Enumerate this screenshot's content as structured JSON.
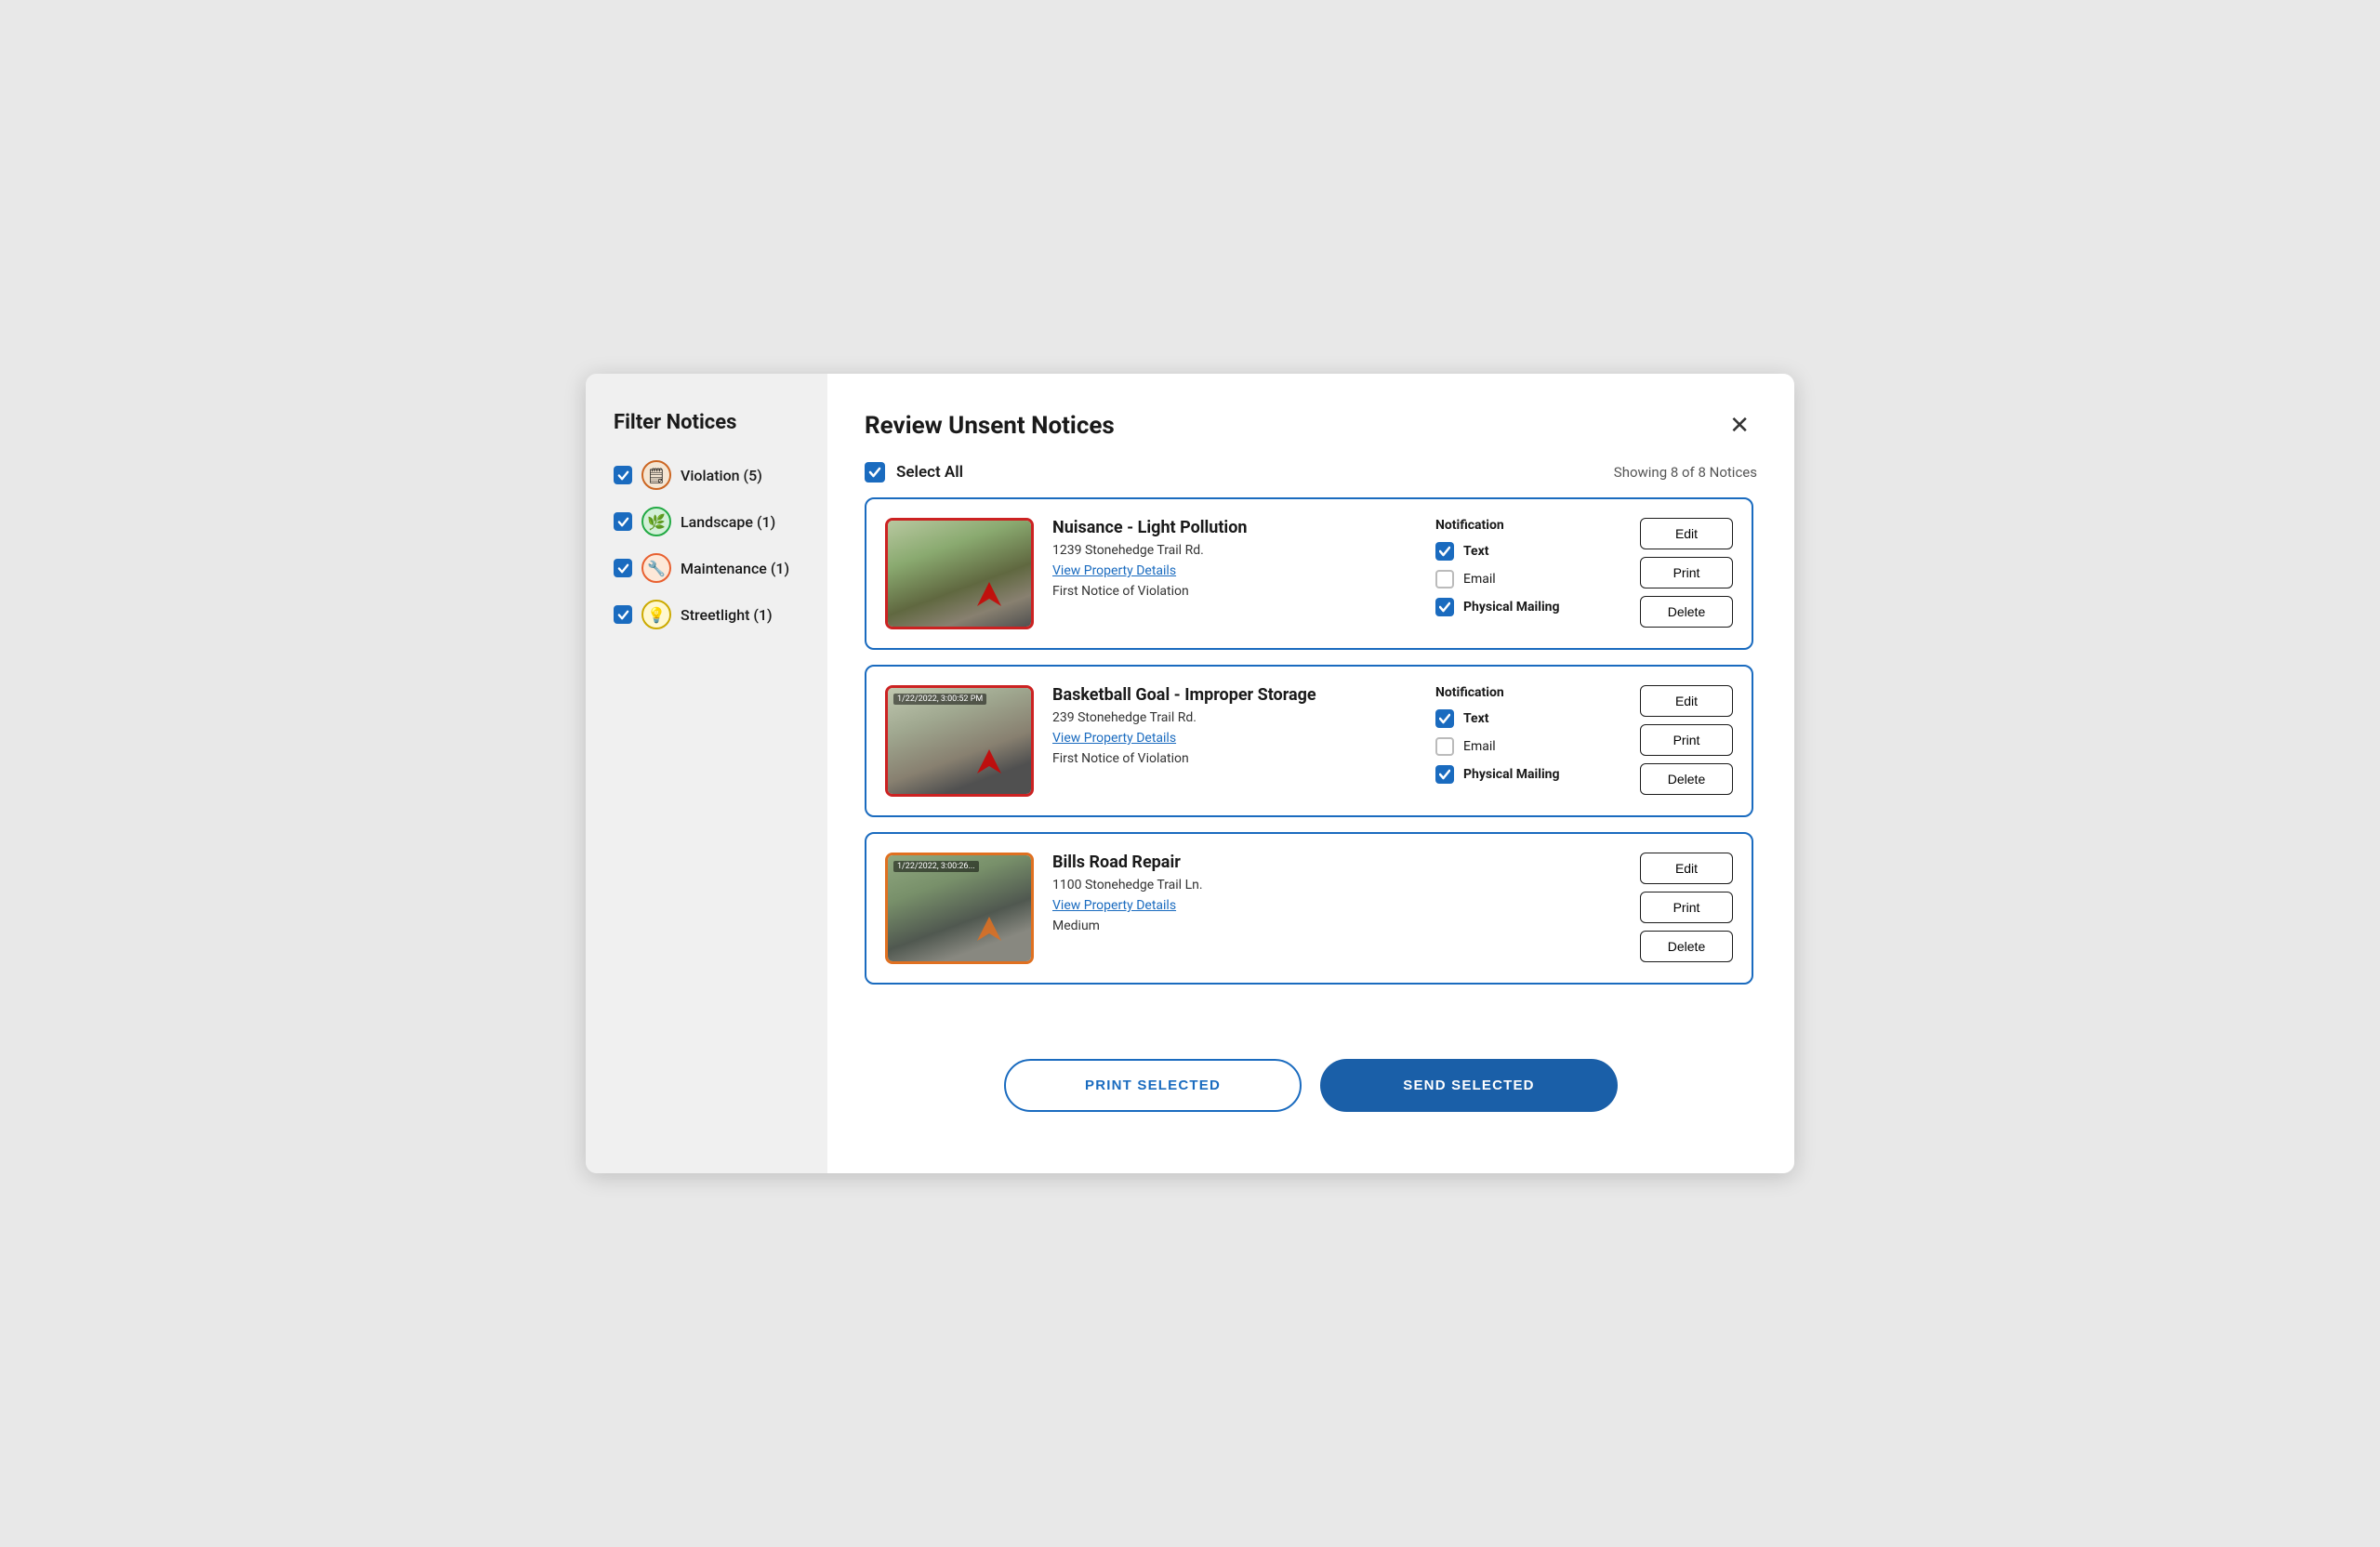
{
  "sidebar": {
    "title": "Filter Notices",
    "filters": [
      {
        "id": "violation",
        "label": "Violation (5)",
        "icon": "🗒",
        "iconClass": "icon-violation",
        "checked": true
      },
      {
        "id": "landscape",
        "label": "Landscape (1)",
        "icon": "🌿",
        "iconClass": "icon-landscape",
        "checked": true
      },
      {
        "id": "maintenance",
        "label": "Maintenance (1)",
        "icon": "🔧",
        "iconClass": "icon-maintenance",
        "checked": true
      },
      {
        "id": "streetlight",
        "label": "Streetlight (1)",
        "icon": "💡",
        "iconClass": "icon-streetlight",
        "checked": true
      }
    ]
  },
  "modal": {
    "title": "Review Unsent Notices",
    "select_all_label": "Select All",
    "showing_text": "Showing 8 of 8 Notices",
    "notices": [
      {
        "id": "notice-1",
        "title": "Nuisance - Light Pollution",
        "address": "1239 Stonehedge Trail Rd.",
        "link": "View Property Details",
        "sub": "First Notice of Violation",
        "timestamp": "",
        "border_color": "red",
        "notification": {
          "label": "Notification",
          "items": [
            {
              "checked": true,
              "label": "Text",
              "bold": true
            },
            {
              "checked": false,
              "label": "Email",
              "bold": false
            },
            {
              "checked": true,
              "label": "Physical Mailing",
              "bold": true
            }
          ]
        }
      },
      {
        "id": "notice-2",
        "title": "Basketball Goal - Improper Storage",
        "address": "239 Stonehedge Trail Rd.",
        "link": "View Property Details",
        "sub": "First Notice of Violation",
        "timestamp": "1/22/2022, 3:00:52 PM",
        "border_color": "red",
        "notification": {
          "label": "Notification",
          "items": [
            {
              "checked": true,
              "label": "Text",
              "bold": true
            },
            {
              "checked": false,
              "label": "Email",
              "bold": false
            },
            {
              "checked": true,
              "label": "Physical Mailing",
              "bold": true
            }
          ]
        }
      },
      {
        "id": "notice-3",
        "title": "Bills Road Repair",
        "address": "1100 Stonehedge Trail Ln.",
        "link": "View Property Details",
        "sub": "Medium",
        "timestamp": "1/22/2022, 3:00:26...",
        "border_color": "orange",
        "notification": null
      }
    ],
    "footer": {
      "print_label": "PRINT SELECTED",
      "send_label": "SEND SELECTED"
    }
  }
}
